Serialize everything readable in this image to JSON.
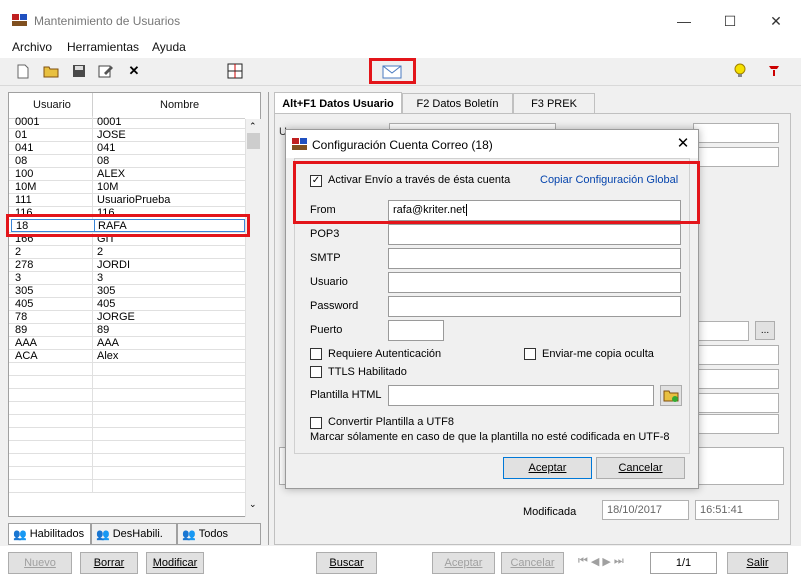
{
  "window": {
    "title": "Mantenimiento de Usuarios",
    "minimize": "—",
    "maximize": "☐",
    "close": "✕"
  },
  "menu": [
    "Archivo",
    "Herramientas",
    "Ayuda"
  ],
  "grid": {
    "headers": [
      "Usuario",
      "Nombre"
    ],
    "rows": [
      [
        "0001",
        "0001"
      ],
      [
        "01",
        "JOSE"
      ],
      [
        "041",
        "041"
      ],
      [
        "08",
        "08"
      ],
      [
        "100",
        "ALEX"
      ],
      [
        "10M",
        "10M"
      ],
      [
        "111",
        "UsuarioPrueba"
      ],
      [
        "116",
        "116"
      ],
      [
        "",
        ""
      ],
      [
        "166",
        "GIT"
      ],
      [
        "2",
        "2"
      ],
      [
        "278",
        "JORDI"
      ],
      [
        "3",
        "3"
      ],
      [
        "305",
        "305"
      ],
      [
        "405",
        "405"
      ],
      [
        "78",
        "JORGE"
      ],
      [
        "89",
        "89"
      ],
      [
        "AAA",
        "AAA"
      ],
      [
        "ACA",
        "Alex"
      ]
    ],
    "selected": {
      "usuario": "18",
      "nombre": "RAFA"
    }
  },
  "filters": [
    "Habilitados",
    "DesHabili.",
    "Todos"
  ],
  "tabs": [
    "Alt+F1 Datos Usuario",
    "F2 Datos Boletín",
    "F3 PREK"
  ],
  "right": {
    "modificada_label": "Modificada",
    "modificada_date": "18/10/2017",
    "modificada_time": "16:51:41",
    "ellipsis": "..."
  },
  "bottom_buttons": {
    "nuevo": "Nuevo",
    "borrar": "Borrar",
    "modificar": "Modificar",
    "buscar": "Buscar",
    "aceptar": "Aceptar",
    "cancelar": "Cancelar",
    "page": "1/1",
    "salir": "Salir"
  },
  "dialog": {
    "title": "Configuración Cuenta Correo (18)",
    "activar_label": "Activar Envío a través de ésta cuenta",
    "copiar_link": "Copiar Configuración Global",
    "from_label": "From",
    "from_value": "rafa@kriter.net",
    "pop3_label": "POP3",
    "smtp_label": "SMTP",
    "usuario_label": "Usuario",
    "password_label": "Password",
    "puerto_label": "Puerto",
    "requiere_label": "Requiere Autenticación",
    "enviar_copia_label": "Enviar-me copia oculta",
    "ttls_label": "TTLS Habilitado",
    "plantilla_label": "Plantilla HTML",
    "convertir_label": "Convertir Plantilla a UTF8",
    "marcar_note": "Marcar sólamente en caso de que la plantilla no esté codificada en UTF-8",
    "aceptar": "Aceptar",
    "cancelar": "Cancelar"
  },
  "colors": {
    "highlight": "#e3151a",
    "link": "#0645ad"
  }
}
